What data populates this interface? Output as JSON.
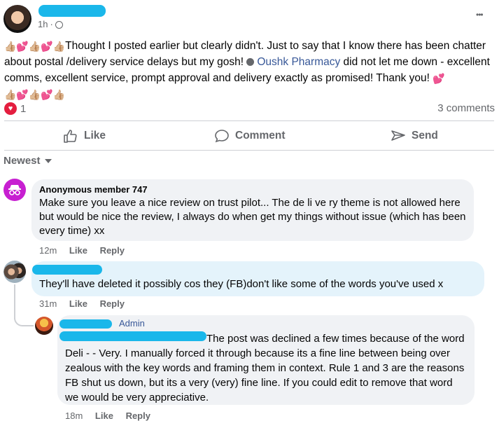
{
  "post": {
    "time": "1h",
    "dot": "·",
    "more": "•••",
    "emoji_prefix": "👍🏼💕👍🏼💕👍🏼",
    "text_1": "Thought I posted earlier but clearly didn't. Just to say that I know there has been chatter about postal /delivery service delays but my gosh! ",
    "mention": "Oushk Pharmacy",
    "text_2": " did not let me down - excellent comms, excellent service, prompt approval and delivery exactly as promised!  Thank you!  ",
    "emoji_heart": "💕",
    "emoji_suffix": "👍🏼💕👍🏼💕👍🏼",
    "reaction_count": "1",
    "comments_count": "3 comments"
  },
  "actions": {
    "like": "Like",
    "comment": "Comment",
    "send": "Send"
  },
  "sort": {
    "label": "Newest"
  },
  "comments": [
    {
      "author": "Anonymous member 747",
      "text": "Make sure you leave a nice review on trust pilot... The de li ve ry theme is not allowed here but would be nice the review, I always do when get my things without issue (which has been every time) xx",
      "time": "12m",
      "like": "Like",
      "reply": "Reply"
    },
    {
      "text": "They'll have deleted it possibly cos they (FB)don't like some of the words you've used x",
      "time": "31m",
      "like": "Like",
      "reply": "Reply"
    },
    {
      "badge": "Admin",
      "text": "The post was declined a few times because of the word Deli - - Very. I manually forced it through because its a fine line between being over zealous with the key words and framing them in context. Rule 1 and 3 are the reasons FB shut us down, but its a very (very) fine line. If you could edit to remove that word we would be very appreciative.",
      "time": "18m",
      "like": "Like",
      "reply": "Reply"
    }
  ],
  "colors": {
    "link": "#385898",
    "accent": "#1ab7ea",
    "reaction": "#e41e3f",
    "anon": "#c71fd1"
  }
}
